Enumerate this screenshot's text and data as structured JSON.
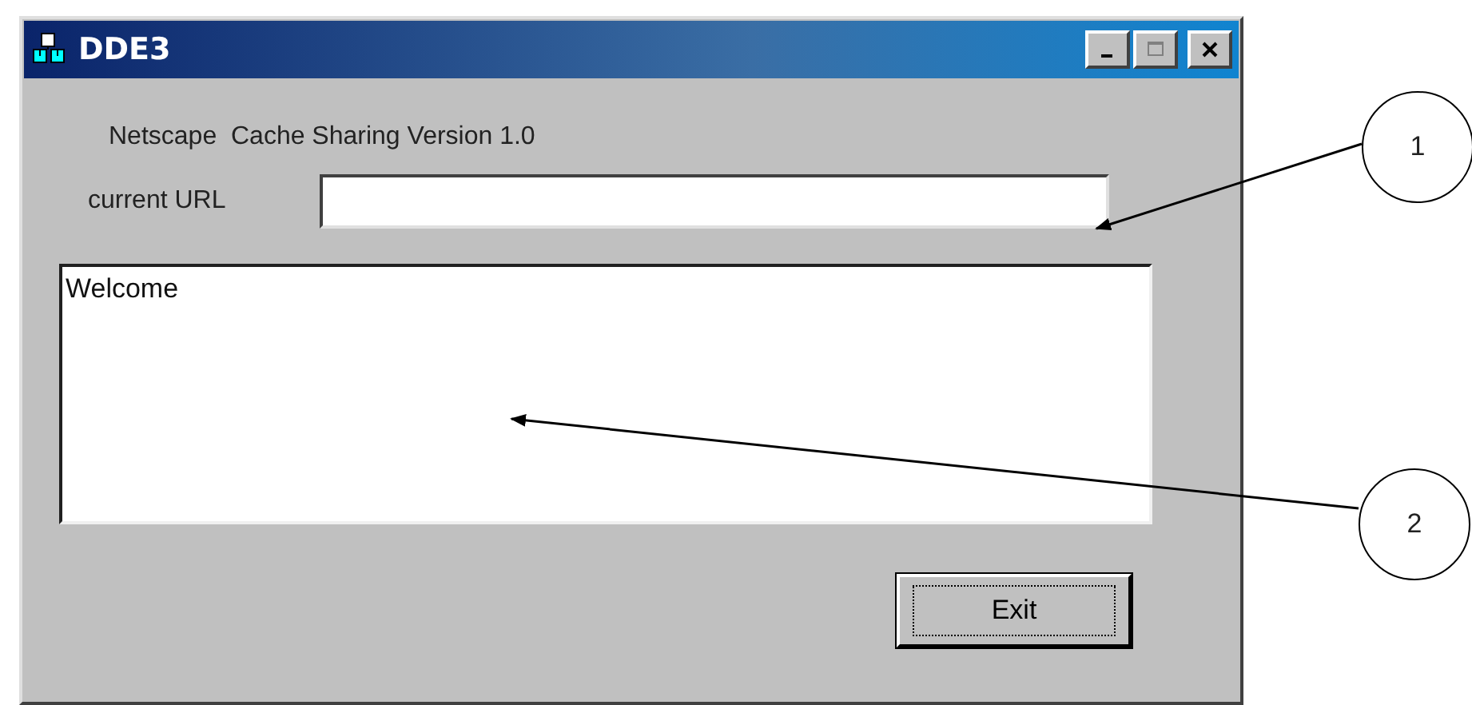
{
  "window": {
    "title": "DDE3",
    "controls": [
      {
        "kind": "minimize",
        "disabled": false
      },
      {
        "kind": "maximize",
        "disabled": true
      },
      {
        "kind": "close",
        "disabled": false
      }
    ]
  },
  "heading": "Netscape  Cache Sharing Version 1.0",
  "url_field": {
    "label": "current URL"
  },
  "log": {
    "value": "Welcome"
  },
  "exit_button": {
    "label": "Exit",
    "focused": true
  },
  "callouts": [
    {
      "label": "1"
    },
    {
      "label": "2"
    }
  ]
}
